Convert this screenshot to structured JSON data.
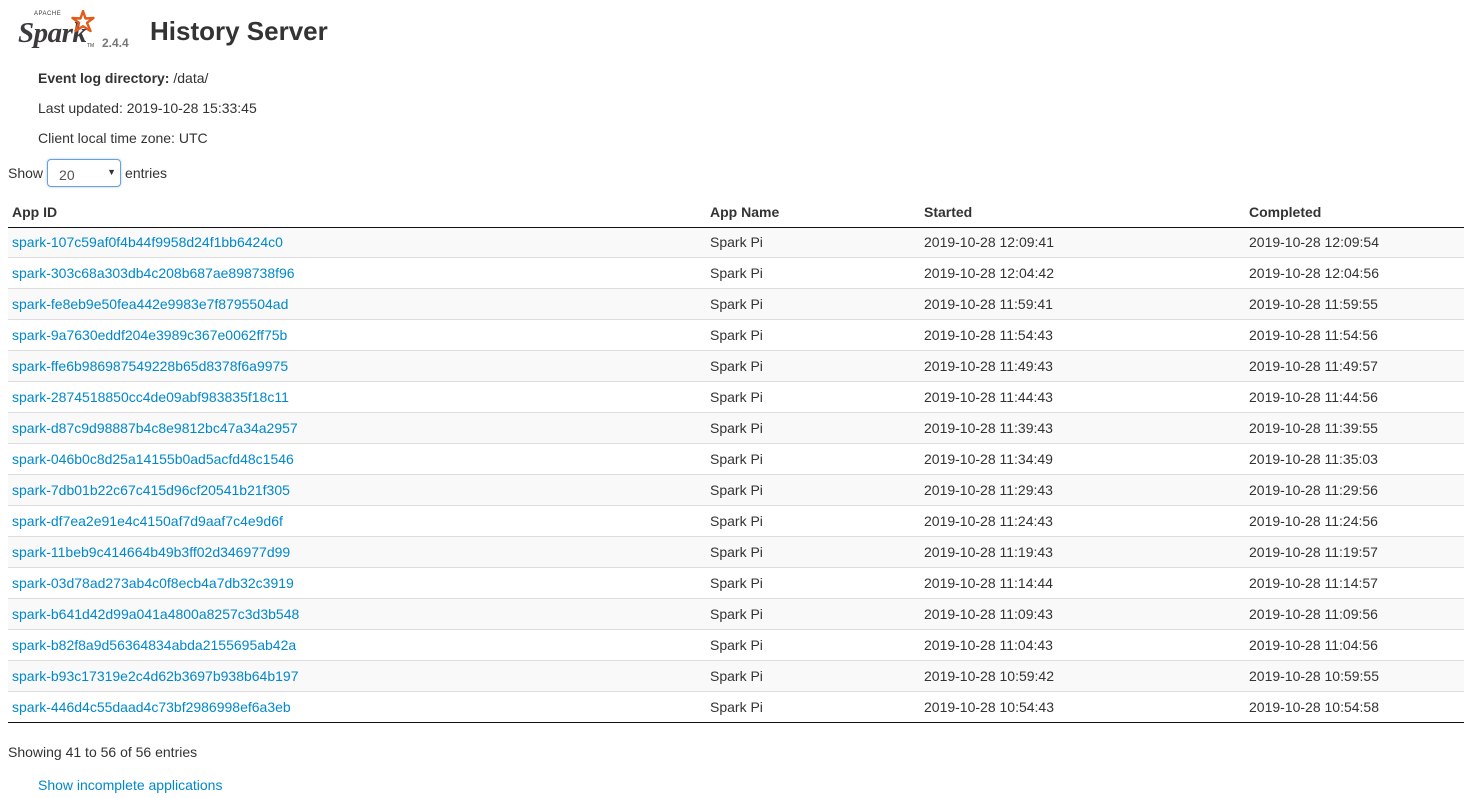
{
  "header": {
    "logo_apache": "APACHE",
    "logo_spark": "Spark",
    "logo_tm": "TM",
    "version": "2.4.4",
    "title": "History Server"
  },
  "info": {
    "event_log_label": "Event log directory:",
    "event_log_value": "/data/",
    "last_updated": "Last updated: 2019-10-28 15:33:45",
    "timezone": "Client local time zone: UTC"
  },
  "length_control": {
    "show_label": "Show",
    "selected": "20",
    "entries_label": "entries"
  },
  "table": {
    "columns": [
      "App ID",
      "App Name",
      "Started",
      "Completed"
    ],
    "rows": [
      {
        "app_id": "spark-107c59af0f4b44f9958d24f1bb6424c0",
        "app_name": "Spark Pi",
        "started": "2019-10-28 12:09:41",
        "completed": "2019-10-28 12:09:54"
      },
      {
        "app_id": "spark-303c68a303db4c208b687ae898738f96",
        "app_name": "Spark Pi",
        "started": "2019-10-28 12:04:42",
        "completed": "2019-10-28 12:04:56"
      },
      {
        "app_id": "spark-fe8eb9e50fea442e9983e7f8795504ad",
        "app_name": "Spark Pi",
        "started": "2019-10-28 11:59:41",
        "completed": "2019-10-28 11:59:55"
      },
      {
        "app_id": "spark-9a7630eddf204e3989c367e0062ff75b",
        "app_name": "Spark Pi",
        "started": "2019-10-28 11:54:43",
        "completed": "2019-10-28 11:54:56"
      },
      {
        "app_id": "spark-ffe6b986987549228b65d8378f6a9975",
        "app_name": "Spark Pi",
        "started": "2019-10-28 11:49:43",
        "completed": "2019-10-28 11:49:57"
      },
      {
        "app_id": "spark-2874518850cc4de09abf983835f18c11",
        "app_name": "Spark Pi",
        "started": "2019-10-28 11:44:43",
        "completed": "2019-10-28 11:44:56"
      },
      {
        "app_id": "spark-d87c9d98887b4c8e9812bc47a34a2957",
        "app_name": "Spark Pi",
        "started": "2019-10-28 11:39:43",
        "completed": "2019-10-28 11:39:55"
      },
      {
        "app_id": "spark-046b0c8d25a14155b0ad5acfd48c1546",
        "app_name": "Spark Pi",
        "started": "2019-10-28 11:34:49",
        "completed": "2019-10-28 11:35:03"
      },
      {
        "app_id": "spark-7db01b22c67c415d96cf20541b21f305",
        "app_name": "Spark Pi",
        "started": "2019-10-28 11:29:43",
        "completed": "2019-10-28 11:29:56"
      },
      {
        "app_id": "spark-df7ea2e91e4c4150af7d9aaf7c4e9d6f",
        "app_name": "Spark Pi",
        "started": "2019-10-28 11:24:43",
        "completed": "2019-10-28 11:24:56"
      },
      {
        "app_id": "spark-11beb9c414664b49b3ff02d346977d99",
        "app_name": "Spark Pi",
        "started": "2019-10-28 11:19:43",
        "completed": "2019-10-28 11:19:57"
      },
      {
        "app_id": "spark-03d78ad273ab4c0f8ecb4a7db32c3919",
        "app_name": "Spark Pi",
        "started": "2019-10-28 11:14:44",
        "completed": "2019-10-28 11:14:57"
      },
      {
        "app_id": "spark-b641d42d99a041a4800a8257c3d3b548",
        "app_name": "Spark Pi",
        "started": "2019-10-28 11:09:43",
        "completed": "2019-10-28 11:09:56"
      },
      {
        "app_id": "spark-b82f8a9d56364834abda2155695ab42a",
        "app_name": "Spark Pi",
        "started": "2019-10-28 11:04:43",
        "completed": "2019-10-28 11:04:56"
      },
      {
        "app_id": "spark-b93c17319e2c4d62b3697b938b64b197",
        "app_name": "Spark Pi",
        "started": "2019-10-28 10:59:42",
        "completed": "2019-10-28 10:59:55"
      },
      {
        "app_id": "spark-446d4c55daad4c73bf2986998ef6a3eb",
        "app_name": "Spark Pi",
        "started": "2019-10-28 10:54:43",
        "completed": "2019-10-28 10:54:58"
      }
    ]
  },
  "footer": {
    "showing": "Showing 41 to 56 of 56 entries",
    "incomplete_link": "Show incomplete applications"
  },
  "colors": {
    "link": "#0088cc",
    "logo_orange": "#e25a1c",
    "logo_dark": "#3c3a3e",
    "stripe": "#f9f9f9"
  }
}
